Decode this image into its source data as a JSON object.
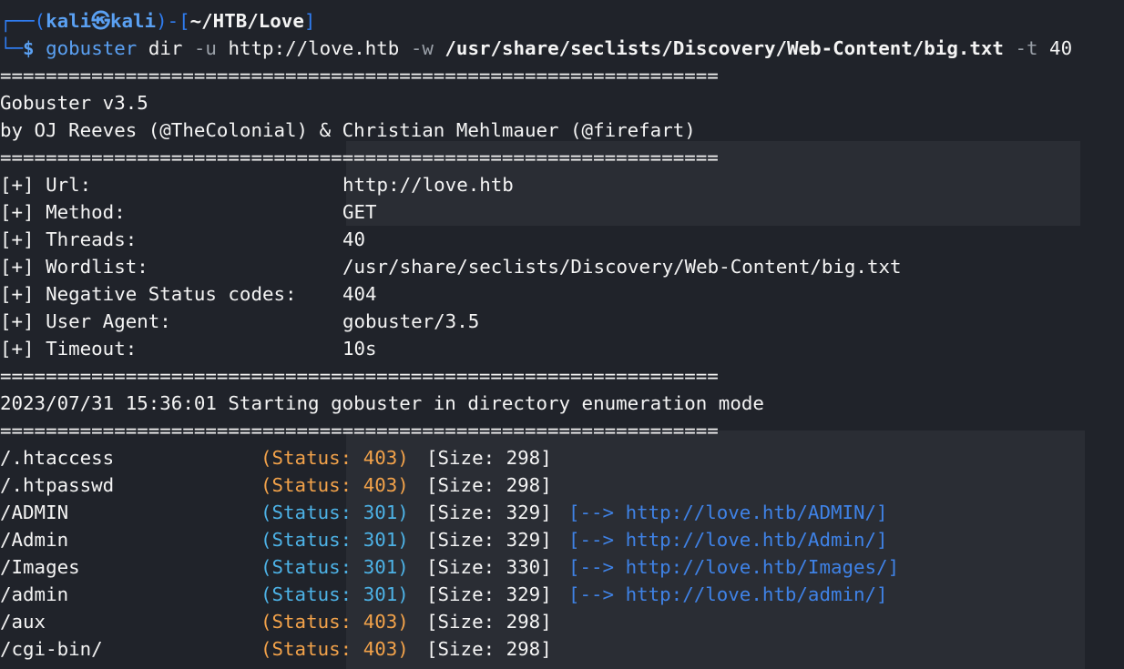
{
  "prompt": {
    "corner_top": "┌──(",
    "user": "kali",
    "at": "㉿",
    "host": "kali",
    "mid": ")-[",
    "path": "~/HTB/Love",
    "end": "]",
    "corner_bottom": "└─",
    "dollar": "$",
    "cmd_name": "gobuster",
    "cmd_sub": "dir",
    "flag_u": "-u",
    "url_arg": "http://love.htb",
    "flag_w": "-w",
    "wordlist_arg": "/usr/share/seclists/Discovery/Web-Content/big.txt",
    "flag_t": "-t",
    "threads_arg": "40"
  },
  "separator": "===============================================================",
  "banner": {
    "version": "Gobuster v3.5",
    "authors": "by OJ Reeves (@TheColonial) & Christian Mehlmauer (@firefart)"
  },
  "settings": [
    {
      "label": "[+] Url:",
      "value": "http://love.htb"
    },
    {
      "label": "[+] Method:",
      "value": "GET"
    },
    {
      "label": "[+] Threads:",
      "value": "40"
    },
    {
      "label": "[+] Wordlist:",
      "value": "/usr/share/seclists/Discovery/Web-Content/big.txt"
    },
    {
      "label": "[+] Negative Status codes:",
      "value": "404"
    },
    {
      "label": "[+] User Agent:",
      "value": "gobuster/3.5"
    },
    {
      "label": "[+] Timeout:",
      "value": "10s"
    }
  ],
  "start_message": "2023/07/31 15:36:01 Starting gobuster in directory enumeration mode",
  "results": [
    {
      "path": "/.htaccess",
      "status_label": "(Status:",
      "status": "403)",
      "size": "[Size: 298]",
      "redirect": "",
      "color": "#f2a24a"
    },
    {
      "path": "/.htpasswd",
      "status_label": "(Status:",
      "status": "403)",
      "size": "[Size: 298]",
      "redirect": "",
      "color": "#f2a24a"
    },
    {
      "path": "/ADMIN",
      "status_label": "(Status:",
      "status": "301)",
      "size": "[Size: 329]",
      "redirect": "[--> http://love.htb/ADMIN/]",
      "color": "#4db2e6"
    },
    {
      "path": "/Admin",
      "status_label": "(Status:",
      "status": "301)",
      "size": "[Size: 329]",
      "redirect": "[--> http://love.htb/Admin/]",
      "color": "#4db2e6"
    },
    {
      "path": "/Images",
      "status_label": "(Status:",
      "status": "301)",
      "size": "[Size: 330]",
      "redirect": "[--> http://love.htb/Images/]",
      "color": "#4db2e6"
    },
    {
      "path": "/admin",
      "status_label": "(Status:",
      "status": "301)",
      "size": "[Size: 329]",
      "redirect": "[--> http://love.htb/admin/]",
      "color": "#4db2e6"
    },
    {
      "path": "/aux",
      "status_label": "(Status:",
      "status": "403)",
      "size": "[Size: 298]",
      "redirect": "",
      "color": "#f2a24a"
    },
    {
      "path": "/cgi-bin/",
      "status_label": "(Status:",
      "status": "403)",
      "size": "[Size: 298]",
      "redirect": "",
      "color": "#f2a24a"
    }
  ],
  "colors": {
    "background": "#20232a",
    "prompt_blue": "#2f7cf0",
    "status_403": "#f2a24a",
    "status_301": "#4db2e6",
    "redirect_link": "#3f82e6"
  }
}
